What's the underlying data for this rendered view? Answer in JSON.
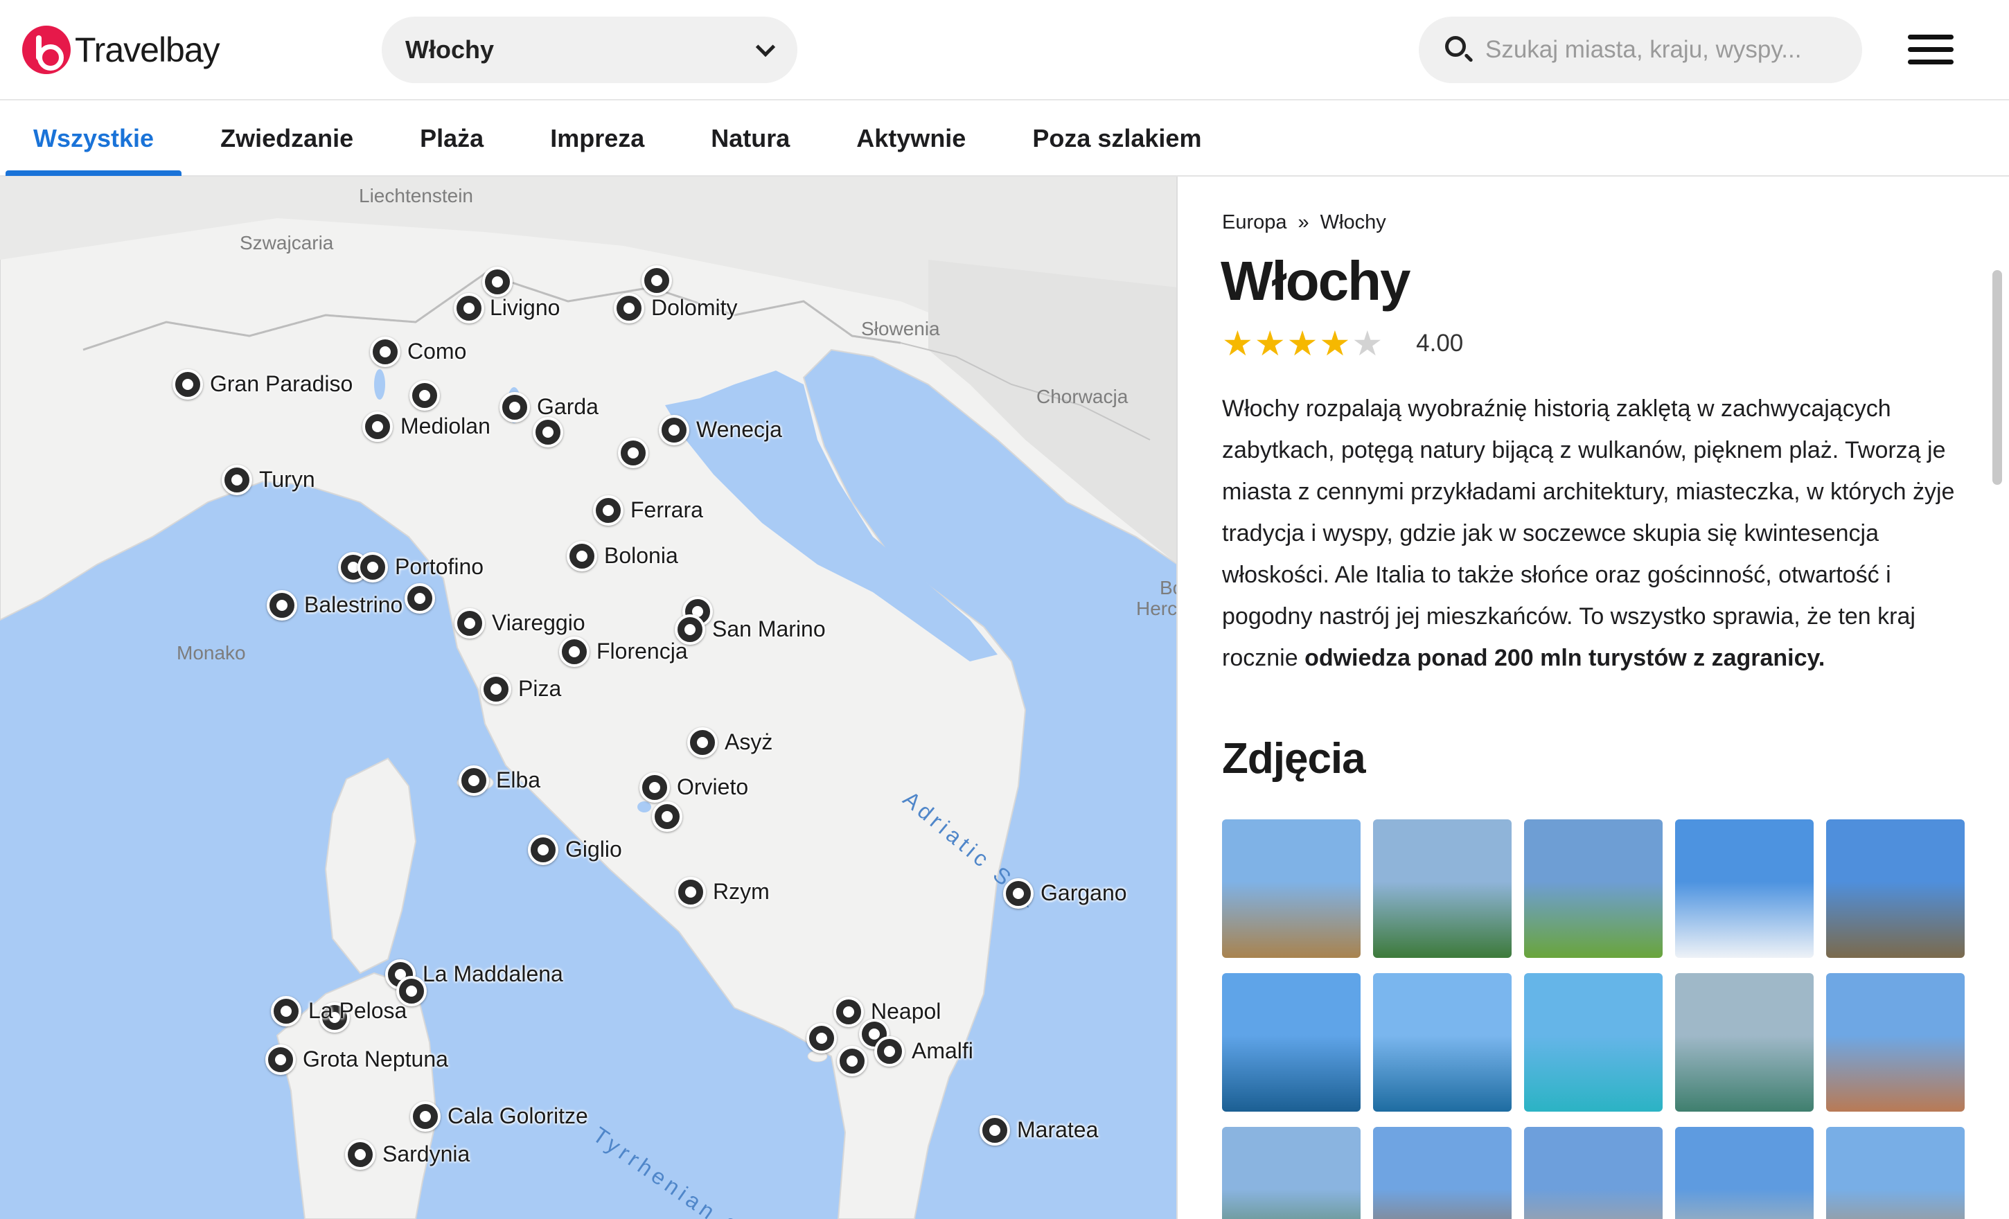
{
  "header": {
    "logo_text": "Travelbay",
    "country_select": "Włochy",
    "search_placeholder": "Szukaj miasta, kraju, wyspy..."
  },
  "tabs": [
    {
      "label": "Wszystkie",
      "active": true
    },
    {
      "label": "Zwiedzanie"
    },
    {
      "label": "Plaża"
    },
    {
      "label": "Impreza"
    },
    {
      "label": "Natura"
    },
    {
      "label": "Aktywnie"
    },
    {
      "label": "Poza szlakiem"
    }
  ],
  "map": {
    "regions": [
      "Liechtenstein",
      "Szwajcaria",
      "Słowenia",
      "Chorwacja",
      "Monako",
      "Bo",
      "Herc"
    ],
    "seas": [
      "Adriatic Sea",
      "Tyrrhenian S"
    ],
    "places": [
      "Livigno",
      "Dolomity",
      "Como",
      "Gran Paradiso",
      "Garda",
      "Mediolan",
      "Wenecja",
      "Turyn",
      "Ferrara",
      "Bolonia",
      "Portofino",
      "Balestrino",
      "Viareggio",
      "San Marino",
      "Florencja",
      "Piza",
      "Asyż",
      "Elba",
      "Orvieto",
      "Giglio",
      "Rzym",
      "Gargano",
      "La Maddalena",
      "La Pelosa",
      "Grota Neptuna",
      "Neapol",
      "Amalfi",
      "Cala Goloritze",
      "Maratea",
      "Sardynia"
    ]
  },
  "panel": {
    "breadcrumb": [
      "Europa",
      "»",
      "Włochy"
    ],
    "title": "Włochy",
    "rating": {
      "value": "4.00",
      "stars": 4,
      "max": 5
    },
    "description_text": "Włochy rozpalają wyobraźnię historią zaklętą w zachwycających zabytkach, potęgą natury bijącą z wulkanów, pięknem plaż. Tworzą je miasta z cennymi przykładami architektury, miasteczka, w których żyje tradycja i wyspy, gdzie jak w soczewce skupia się kwintesencja włoskości. Ale Italia to także słońce oraz gościnność, otwartość i pogodny nastrój jej mieszkańców. To wszystko sprawia, że ten kraj rocznie ",
    "description_bold": "odwiedza ponad 200 mln turystów z zagranicy.",
    "photos_title": "Zdjęcia",
    "photos": [
      {
        "name": "colosseum-photo",
        "top": "#7fb2e6",
        "bottom": "#a9834e"
      },
      {
        "name": "etna-photo",
        "top": "#8fb4d9",
        "bottom": "#3d7a3a"
      },
      {
        "name": "dolomites-photo",
        "top": "#6e9ed4",
        "bottom": "#6aa53b"
      },
      {
        "name": "ski-photo",
        "top": "#4d93e0",
        "bottom": "#eef2f7"
      },
      {
        "name": "alpine-town-photo",
        "top": "#4f8fdc",
        "bottom": "#7b6a4c"
      },
      {
        "name": "cinque-terre-photo",
        "top": "#5fa4e8",
        "bottom": "#1b5f93"
      },
      {
        "name": "capri-photo",
        "top": "#7ab6ee",
        "bottom": "#1e6ca1"
      },
      {
        "name": "beach-photo",
        "top": "#65b5e8",
        "bottom": "#2bb3c4"
      },
      {
        "name": "venice-photo",
        "top": "#9fb8c8",
        "bottom": "#3f7f6e"
      },
      {
        "name": "bologna-photo",
        "top": "#6ea7e4",
        "bottom": "#b97a55"
      },
      {
        "name": "sicily-volcano-photo",
        "top": "#8ab4e0",
        "bottom": "#4c7a42"
      },
      {
        "name": "colosseum-2-photo",
        "top": "#6fa4e2",
        "bottom": "#9a6b3e"
      },
      {
        "name": "vatican-photo",
        "top": "#6d9fdc",
        "bottom": "#c8a57b"
      },
      {
        "name": "pisa-photo",
        "top": "#5e9be0",
        "bottom": "#d7c49e"
      },
      {
        "name": "palermo-photo",
        "top": "#78aee6",
        "bottom": "#b88a55"
      }
    ]
  }
}
